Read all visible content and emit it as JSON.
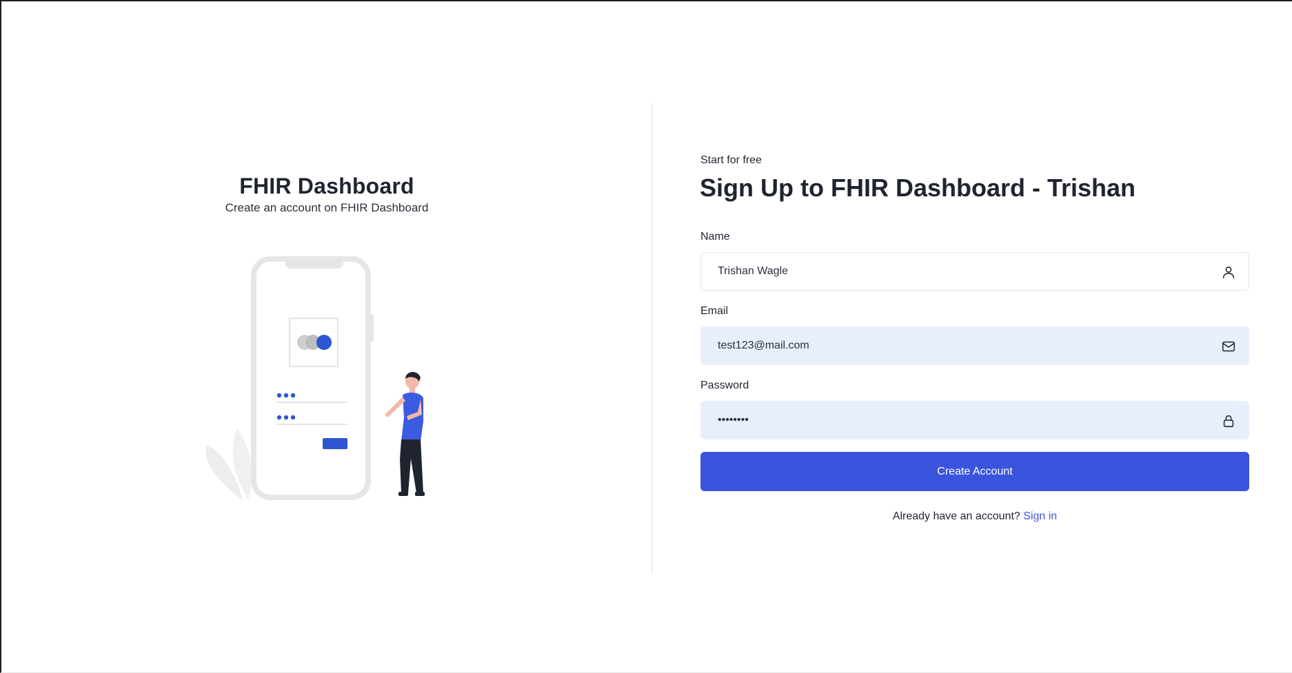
{
  "left_panel": {
    "title": "FHIR Dashboard",
    "subtitle": "Create an account on FHIR Dashboard"
  },
  "form": {
    "eyebrow": "Start for free",
    "heading": "Sign Up to FHIR Dashboard - Trishan",
    "name": {
      "label": "Name",
      "value": "Trishan Wagle",
      "icon": "user-icon"
    },
    "email": {
      "label": "Email",
      "value": "test123@mail.com",
      "icon": "mail-icon"
    },
    "password": {
      "label": "Password",
      "value": "password",
      "icon": "lock-icon"
    },
    "submit_label": "Create Account",
    "signin_prompt": "Already have an account?",
    "signin_link": "Sign in"
  },
  "colors": {
    "accent": "#3b54de",
    "filled_input_bg": "#e8effc",
    "text": "#1f2430"
  }
}
